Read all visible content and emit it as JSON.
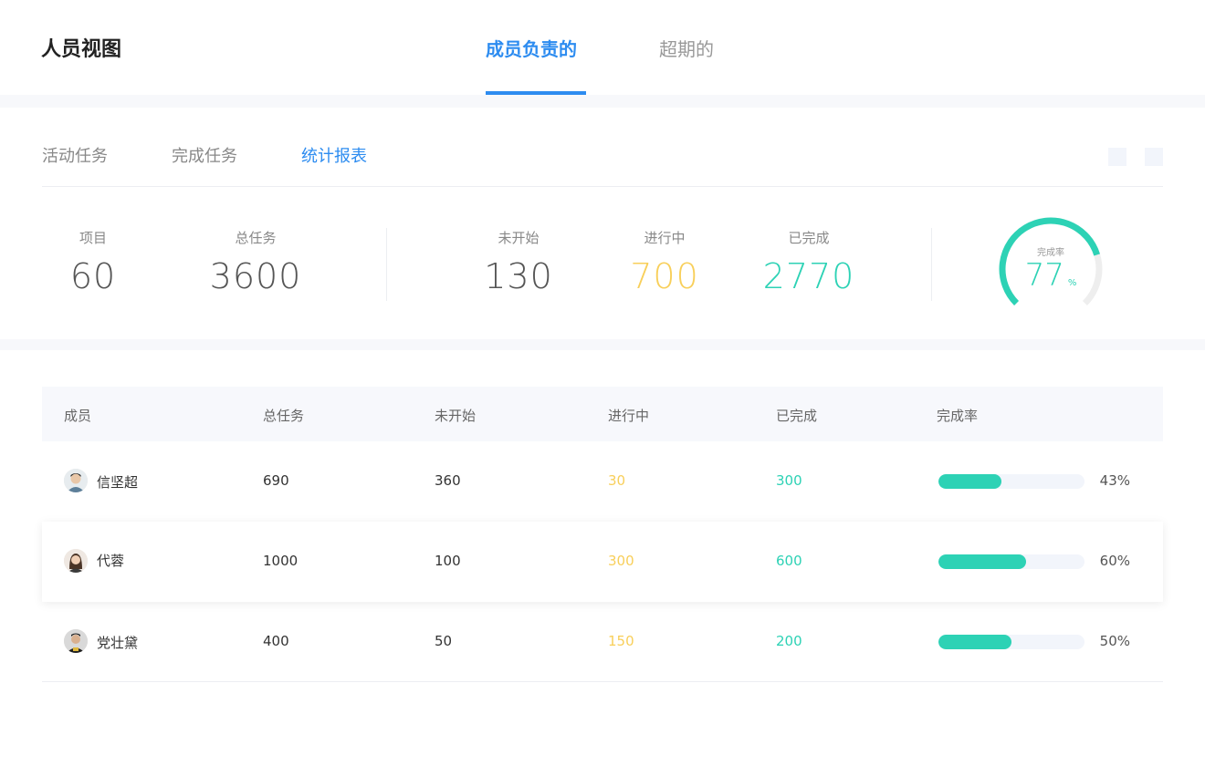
{
  "header": {
    "title": "人员视图",
    "tabs": [
      "成员负责的",
      "超期的"
    ],
    "active_tab": "成员负责的"
  },
  "subtabs": {
    "items": [
      "活动任务",
      "完成任务",
      "统计报表"
    ],
    "active": "统计报表"
  },
  "summary": {
    "project_label": "项目",
    "project_value": "60",
    "total_label": "总任务",
    "total_value": "3600",
    "not_started_label": "未开始",
    "not_started_value": "130",
    "in_progress_label": "进行中",
    "in_progress_value": "700",
    "done_label": "已完成",
    "done_value": "2770",
    "rate_label": "完成率",
    "rate_value": "77",
    "rate_unit": "%",
    "rate_fraction": 0.77
  },
  "table": {
    "headers": [
      "成员",
      "总任务",
      "未开始",
      "进行中",
      "已完成",
      "完成率"
    ],
    "rows": [
      {
        "name": "信坚超",
        "total": "690",
        "not_started": "360",
        "in_progress": "30",
        "done": "300",
        "rate_text": "43%",
        "rate": 0.43
      },
      {
        "name": "代蓉",
        "total": "1000",
        "not_started": "100",
        "in_progress": "300",
        "done": "600",
        "rate_text": "60%",
        "rate": 0.6
      },
      {
        "name": "党壮黛",
        "total": "400",
        "not_started": "50",
        "in_progress": "150",
        "done": "200",
        "rate_text": "50%",
        "rate": 0.5
      }
    ]
  },
  "colors": {
    "accent": "#2d8cf0",
    "in_progress": "#f8cf5a",
    "done": "#2dd2b5",
    "gauge_track": "#eeeeee"
  }
}
